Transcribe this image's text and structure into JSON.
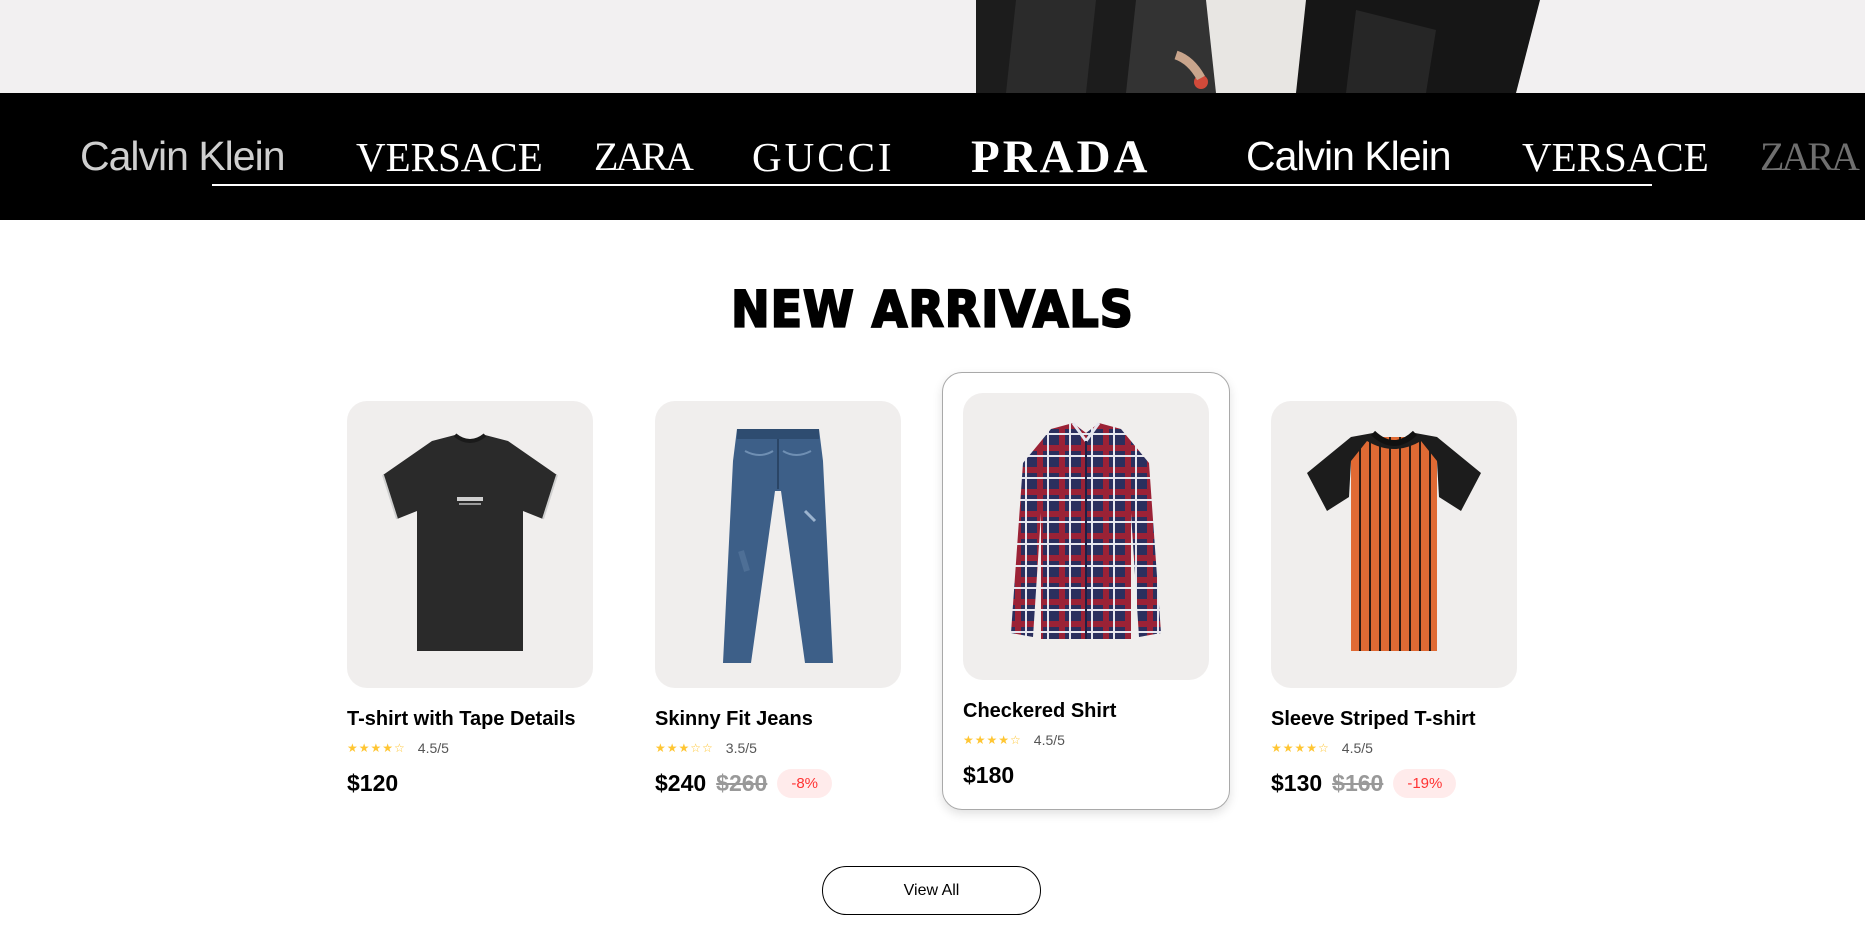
{
  "brands": [
    {
      "name": "Calvin Klein",
      "style": "ck"
    },
    {
      "name": "VERSACE",
      "style": "versace"
    },
    {
      "name": "ZARA",
      "style": "zara"
    },
    {
      "name": "GUCCI",
      "style": "gucci"
    },
    {
      "name": "PRADA",
      "style": "prada"
    },
    {
      "name": "Calvin Klein",
      "style": "ck"
    },
    {
      "name": "VERSACE",
      "style": "versace"
    },
    {
      "name": "ZARA",
      "style": "zara"
    }
  ],
  "section": {
    "title": "NEW ARRIVALS"
  },
  "products": [
    {
      "name": "T-shirt with Tape Details",
      "stars": "★★★★☆",
      "rating": "4.5/5",
      "price": "$120",
      "old_price": "",
      "discount": "",
      "image": "tshirt-icon"
    },
    {
      "name": "Skinny Fit Jeans",
      "stars": "★★★☆☆",
      "rating": "3.5/5",
      "price": "$240",
      "old_price": "$260",
      "discount": "-8%",
      "image": "jeans-icon"
    },
    {
      "name": "Checkered Shirt",
      "stars": "★★★★☆",
      "rating": "4.5/5",
      "price": "$180",
      "old_price": "",
      "discount": "",
      "image": "checkered-shirt-icon"
    },
    {
      "name": "Sleeve Striped T-shirt",
      "stars": "★★★★☆",
      "rating": "4.5/5",
      "price": "$130",
      "old_price": "$160",
      "discount": "-19%",
      "image": "striped-tshirt-icon"
    }
  ],
  "view_all_label": "View All",
  "colors": {
    "star": "#ffc633",
    "discount_bg": "#ffebeb",
    "discount_text": "#ff3333",
    "card_bg": "#f0eeed"
  }
}
